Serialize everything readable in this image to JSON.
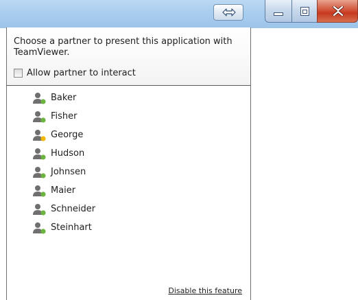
{
  "titlebar": {
    "share_icon": "double-arrow-icon",
    "minimize_icon": "minimize-icon",
    "maximize_icon": "maximize-icon",
    "close_icon": "close-icon"
  },
  "panel": {
    "prompt": "Choose a partner to present this application with TeamViewer.",
    "allow_label": "Allow partner to interact",
    "allow_checked": false,
    "disable_link": "Disable this feature"
  },
  "partners": [
    {
      "name": "Baker",
      "status": "online",
      "status_color": "#6cb33f"
    },
    {
      "name": "Fisher",
      "status": "online",
      "status_color": "#6cb33f"
    },
    {
      "name": "George",
      "status": "away",
      "status_color": "#f2b705"
    },
    {
      "name": "Hudson",
      "status": "online",
      "status_color": "#6cb33f"
    },
    {
      "name": "Johnsen",
      "status": "online",
      "status_color": "#6cb33f"
    },
    {
      "name": "Maier",
      "status": "online",
      "status_color": "#6cb33f"
    },
    {
      "name": "Schneider",
      "status": "online",
      "status_color": "#6cb33f"
    },
    {
      "name": "Steinhart",
      "status": "online",
      "status_color": "#6cb33f"
    }
  ]
}
